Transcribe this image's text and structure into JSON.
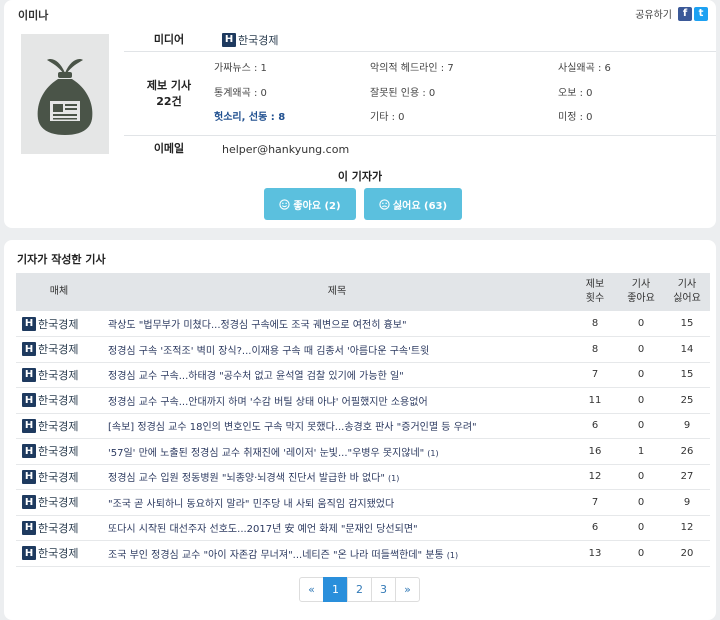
{
  "reporter": {
    "name": "이미나",
    "share_label": "공유하기",
    "media_label": "미디어",
    "media_name": "한국경제",
    "reports_label": "제보 기사",
    "reports_count": "22건",
    "email_label": "이메일",
    "email": "helper@hankyung.com"
  },
  "stats": [
    {
      "label": "가짜뉴스",
      "value": "1"
    },
    {
      "label": "악의적 헤드라인",
      "value": "7"
    },
    {
      "label": "사실왜곡",
      "value": "6"
    },
    {
      "label": "통계왜곡",
      "value": "0"
    },
    {
      "label": "잘못된 인용",
      "value": "0"
    },
    {
      "label": "오보",
      "value": "0"
    },
    {
      "label": "헛소리, 선동",
      "value": "8"
    },
    {
      "label": "기타",
      "value": "0"
    },
    {
      "label": "미정",
      "value": "0"
    }
  ],
  "verdict": {
    "title": "이 기자가",
    "like_label": "좋아요 (2)",
    "dislike_label": "싫어요 (63)"
  },
  "articles_section": {
    "title": "기자가 작성한 기사",
    "headers": [
      "매체",
      "제목",
      "제보\n횟수",
      "기사\n좋아요",
      "기사\n싫어요"
    ]
  },
  "articles": [
    {
      "media": "한국경제",
      "title": "곽상도 \"법무부가 미쳤다...정경심 구속에도 조국 궤변으로 여전히 흉보\"",
      "comments": "",
      "reports": "8",
      "likes": "0",
      "dislikes": "15"
    },
    {
      "media": "한국경제",
      "title": "정경심 구속 '조적조' 벽미 장식?...이재용 구속 때 김종서 '아름다운 구속'트윗",
      "comments": "",
      "reports": "8",
      "likes": "0",
      "dislikes": "14"
    },
    {
      "media": "한국경제",
      "title": "정경심 교수 구속...하태경 \"공수처 없고 윤석열 검찰 있기에 가능한 일\"",
      "comments": "",
      "reports": "7",
      "likes": "0",
      "dislikes": "15"
    },
    {
      "media": "한국경제",
      "title": "정경심 교수 구속...안대까지 하며 '수감 버틸 상태 아냐' 어필했지만 소용없어",
      "comments": "",
      "reports": "11",
      "likes": "0",
      "dislikes": "25"
    },
    {
      "media": "한국경제",
      "title": "[속보] 정경심 교수 18인의 변호인도 구속 막지 못했다...송경호 판사 \"증거인멸 등 우려\"",
      "comments": "",
      "reports": "6",
      "likes": "0",
      "dislikes": "9"
    },
    {
      "media": "한국경제",
      "title": "'57일' 만에 노출된 정경심 교수 취재진에 '레이저' 눈빛...\"우병우 못지않네\"",
      "comments": "(1)",
      "reports": "16",
      "likes": "1",
      "dislikes": "26"
    },
    {
      "media": "한국경제",
      "title": "정경심 교수 입원 정동병원 \"뇌종양·뇌경색 진단서 발급한 바 없다\"",
      "comments": "(1)",
      "reports": "12",
      "likes": "0",
      "dislikes": "27"
    },
    {
      "media": "한국경제",
      "title": "\"조국 곧 사퇴하니 동요하지 말라\" 민주당 내 사퇴 움직임 감지됐었다",
      "comments": "",
      "reports": "7",
      "likes": "0",
      "dislikes": "9"
    },
    {
      "media": "한국경제",
      "title": "또다시 시작된 대선주자 선호도...2017년 安 예언 화제 \"문재인 당선되면\"",
      "comments": "",
      "reports": "6",
      "likes": "0",
      "dislikes": "12"
    },
    {
      "media": "한국경제",
      "title": "조국 부인 정경심 교수 \"아이 자존감 무너져\"...네티즌 \"온 나라 떠들썩한데\" 분통",
      "comments": "(1)",
      "reports": "13",
      "likes": "0",
      "dislikes": "20"
    }
  ],
  "pagination": {
    "prev": "«",
    "pages": [
      "1",
      "2",
      "3"
    ],
    "next": "»",
    "current": "1"
  },
  "icons": {
    "logo_letter": "H",
    "facebook": "f",
    "twitter": "t"
  },
  "colors": {
    "accent": "#5bc0de",
    "active_page": "#2a8fdb",
    "logo_bg": "#1e3a5f",
    "highlight_stat": "#1f4f8f"
  }
}
